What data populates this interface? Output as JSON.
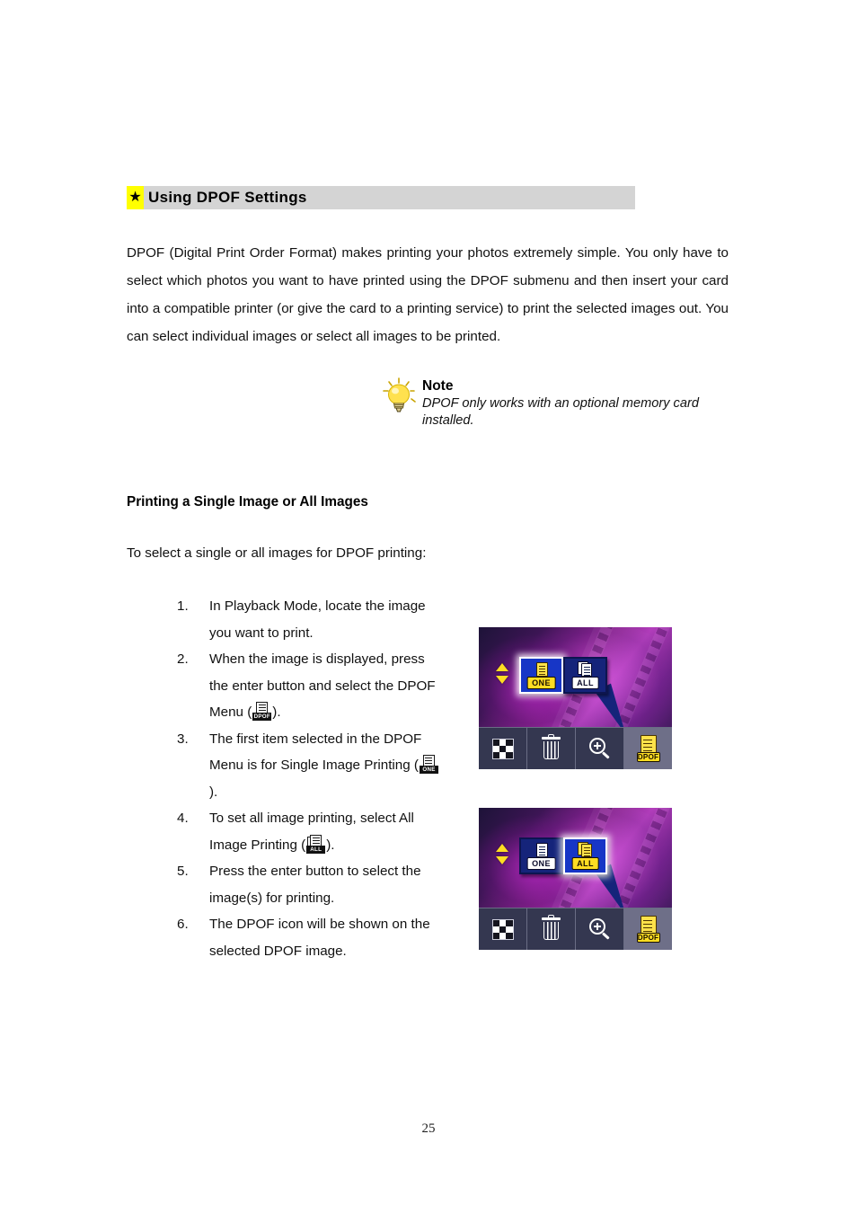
{
  "document": {
    "page_number": "25"
  },
  "section": {
    "star_glyph": "★",
    "title": "Using DPOF Settings",
    "bar_color": "#d4d4d4",
    "star_highlight_color": "#ffff00"
  },
  "intro": {
    "paragraph": "DPOF (Digital Print Order Format) makes printing your photos extremely simple. You only have to select which photos you want to have printed using the DPOF submenu and then insert your card into a compatible printer (or give the card to a printing service) to print the selected images out. You can select individual images or select all images to be printed."
  },
  "note": {
    "icon": "lightbulb-icon",
    "title": "Note",
    "body": "DPOF only works with an optional memory card installed."
  },
  "subsection": {
    "heading": "Printing a Single Image or All Images",
    "lead_in": "To select a single or all images for DPOF printing:"
  },
  "steps": [
    {
      "number": "1.",
      "text_before": "In Playback Mode, locate the image you want to print.",
      "icon": "",
      "text_after": ""
    },
    {
      "number": "2.",
      "text_before": "When the image is displayed, press the enter button and select the DPOF Menu (",
      "icon": "DPOF",
      "text_after": ")."
    },
    {
      "number": "3.",
      "text_before": "The first item selected in the DPOF Menu is for Single Image Printing (",
      "icon": "ONE",
      "text_after": ")."
    },
    {
      "number": "4.",
      "text_before": "To set all image printing, select All Image Printing (",
      "icon": "ALL",
      "text_after": ")."
    },
    {
      "number": "5.",
      "text_before": "Press the enter button to select the image(s) for printing.",
      "icon": "",
      "text_after": ""
    },
    {
      "number": "6.",
      "text_before": "The DPOF icon will be shown on the selected DPOF image.",
      "icon": "",
      "text_after": ""
    }
  ],
  "screenshots": [
    {
      "name": "dpof-menu-one-selected",
      "menu_items": [
        {
          "label": "ONE",
          "selected": true
        },
        {
          "label": "ALL",
          "selected": false
        }
      ],
      "toolbar": [
        {
          "name": "thumbnail-view",
          "label": "",
          "active": false
        },
        {
          "name": "delete",
          "label": "",
          "active": false
        },
        {
          "name": "zoom-in",
          "label": "",
          "active": false
        },
        {
          "name": "dpof",
          "label": "DPOF",
          "active": true
        }
      ],
      "scroll_arrows": {
        "up": "▲",
        "down": "▼",
        "color": "#ffdd22"
      }
    },
    {
      "name": "dpof-menu-all-selected",
      "menu_items": [
        {
          "label": "ONE",
          "selected": false
        },
        {
          "label": "ALL",
          "selected": true
        }
      ],
      "toolbar": [
        {
          "name": "thumbnail-view",
          "label": "",
          "active": false
        },
        {
          "name": "delete",
          "label": "",
          "active": false
        },
        {
          "name": "zoom-in",
          "label": "",
          "active": false
        },
        {
          "name": "dpof",
          "label": "DPOF",
          "active": true
        }
      ],
      "scroll_arrows": {
        "up": "▲",
        "down": "▼",
        "color": "#ffdd22"
      }
    }
  ]
}
